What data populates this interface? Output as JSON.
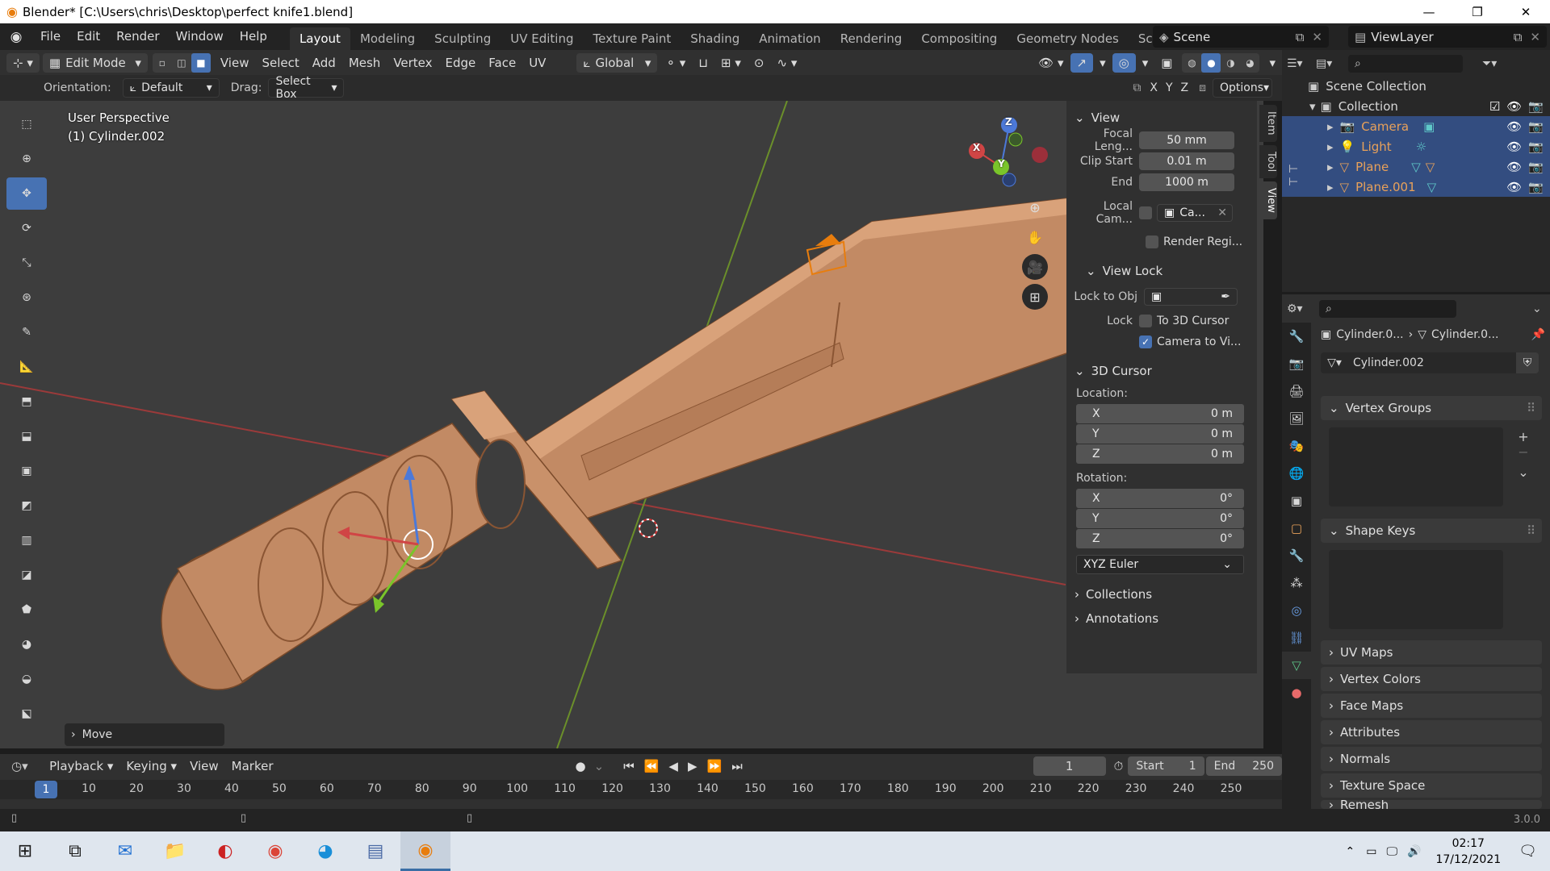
{
  "window": {
    "title": "Blender* [C:\\Users\\chris\\Desktop\\perfect knife1.blend]",
    "minimize": "—",
    "maximize": "❐",
    "close": "✕"
  },
  "menu": [
    "File",
    "Edit",
    "Render",
    "Window",
    "Help"
  ],
  "workspaces": [
    "Layout",
    "Modeling",
    "Sculpting",
    "UV Editing",
    "Texture Paint",
    "Shading",
    "Animation",
    "Rendering",
    "Compositing",
    "Geometry Nodes",
    "Scripting"
  ],
  "active_workspace": "Layout",
  "scene": {
    "name": "Scene",
    "view_layer": "ViewLayer"
  },
  "header": {
    "mode": "Edit Mode",
    "menus": [
      "View",
      "Select",
      "Add",
      "Mesh",
      "Vertex",
      "Edge",
      "Face",
      "UV"
    ],
    "transform_orientation": "Global"
  },
  "tool_options": {
    "orientation_label": "Orientation:",
    "orientation_value": "Default",
    "drag_label": "Drag:",
    "drag_value": "Select Box",
    "axes": [
      "X",
      "Y",
      "Z"
    ],
    "options_label": "Options"
  },
  "viewport": {
    "perspective": "User Perspective",
    "object": "(1) Cylinder.002",
    "last_operator": "Move",
    "gizmo_axes": [
      "X",
      "Y",
      "Z"
    ]
  },
  "tools": [
    "select-box-icon",
    "cursor-icon",
    "move-icon",
    "rotate-icon",
    "scale-icon",
    "transform-icon",
    "annotate-icon",
    "measure-icon",
    "add-cube-icon",
    "extrude-icon",
    "inset-icon",
    "bevel-icon",
    "loop-cut-icon",
    "knife-icon",
    "poly-build-icon",
    "spin-icon",
    "smooth-icon",
    "edge-slide-icon"
  ],
  "active_tool": "move-icon",
  "npanel": {
    "tabs": [
      "Item",
      "Tool",
      "View"
    ],
    "active_tab": "View",
    "view": {
      "title": "View",
      "focal_label": "Focal Leng...",
      "focal_value": "50 mm",
      "clip_start_label": "Clip Start",
      "clip_start_value": "0.01 m",
      "end_label": "End",
      "end_value": "1000 m",
      "local_cam_label": "Local Cam...",
      "local_cam_value": "Ca...",
      "render_region_label": "Render Regi..."
    },
    "view_lock": {
      "title": "View Lock",
      "lock_to_obj_label": "Lock to Obj",
      "lock_label": "Lock",
      "to_3d_cursor_label": "To 3D Cursor",
      "to_3d_cursor_checked": false,
      "camera_to_view_label": "Camera to Vi...",
      "camera_to_view_checked": true
    },
    "cursor": {
      "title": "3D Cursor",
      "location_label": "Location:",
      "location": [
        {
          "axis": "X",
          "value": "0 m"
        },
        {
          "axis": "Y",
          "value": "0 m"
        },
        {
          "axis": "Z",
          "value": "0 m"
        }
      ],
      "rotation_label": "Rotation:",
      "rotation": [
        {
          "axis": "X",
          "value": "0°"
        },
        {
          "axis": "Y",
          "value": "0°"
        },
        {
          "axis": "Z",
          "value": "0°"
        }
      ],
      "rotation_mode": "XYZ Euler"
    },
    "collections": "Collections",
    "annotations": "Annotations"
  },
  "outliner": {
    "scene_collection": "Scene Collection",
    "collection": "Collection",
    "items": [
      {
        "name": "Camera",
        "color": "#e8a15a"
      },
      {
        "name": "Light",
        "color": "#e8a15a"
      },
      {
        "name": "Plane",
        "color": "#e8a15a"
      },
      {
        "name": "Plane.001",
        "color": "#e8a15a"
      }
    ]
  },
  "properties": {
    "breadcrumb_object": "Cylinder.0...",
    "breadcrumb_data": "Cylinder.0...",
    "mesh_name": "Cylinder.002",
    "sections": {
      "vertex_groups": "Vertex Groups",
      "shape_keys": "Shape Keys",
      "uv_maps": "UV Maps",
      "vertex_colors": "Vertex Colors",
      "face_maps": "Face Maps",
      "attributes": "Attributes",
      "normals": "Normals",
      "texture_space": "Texture Space",
      "remesh": "Remesh"
    }
  },
  "timeline": {
    "menus": [
      "Playback",
      "Keying",
      "View",
      "Marker"
    ],
    "current_frame": "1",
    "start_label": "Start",
    "start": "1",
    "end_label": "End",
    "end": "250",
    "ticks": [
      "1",
      "10",
      "20",
      "30",
      "40",
      "50",
      "60",
      "70",
      "80",
      "90",
      "100",
      "110",
      "120",
      "130",
      "140",
      "150",
      "160",
      "170",
      "180",
      "190",
      "200",
      "210",
      "220",
      "230",
      "240",
      "250"
    ]
  },
  "statusbar": {
    "version": "3.0.0"
  },
  "taskbar": {
    "time": "02:17",
    "date": "17/12/2021"
  },
  "colors": {
    "accent": "#4772b3",
    "knife": "#c98f68",
    "selected_orange": "#e87d0d"
  }
}
